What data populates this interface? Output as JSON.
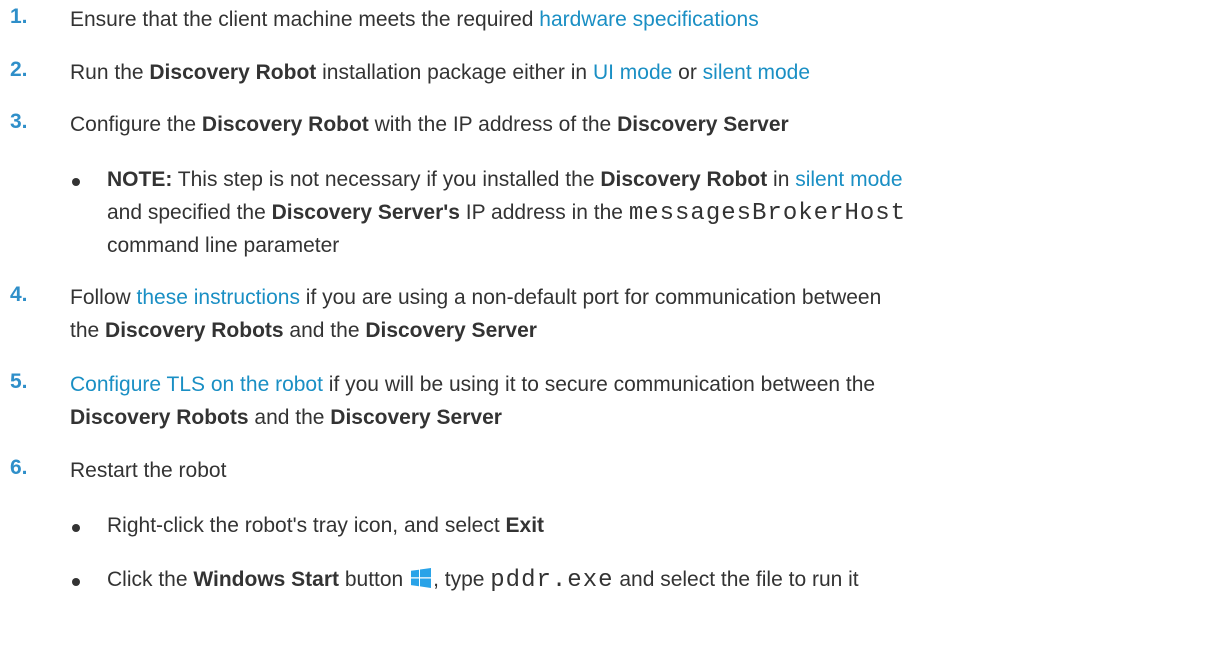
{
  "steps": [
    {
      "number": "1.",
      "parts": {
        "t1": "Ensure that the client machine meets the required ",
        "link1": "hardware specifications"
      }
    },
    {
      "number": "2.",
      "parts": {
        "t1": "Run the ",
        "b1": "Discovery Robot",
        "t2": " installation package either in ",
        "link1": "UI mode",
        "t3": " or ",
        "link2": "silent mode"
      }
    },
    {
      "number": "3.",
      "parts": {
        "t1": "Configure the ",
        "b1": "Discovery Robot",
        "t2": " with the IP address of the ",
        "b2": "Discovery Server"
      },
      "note": {
        "label": "NOTE:",
        "t1": " This step is not necessary if you installed the ",
        "b1": "Discovery Robot",
        "t2": " in ",
        "link1": "silent mode",
        "t3": "and specified the ",
        "b2": "Discovery Server's",
        "t4": " IP address in the ",
        "code": "messagesBrokerHost",
        "t5": "command line parameter"
      }
    },
    {
      "number": "4.",
      "parts": {
        "t1": "Follow ",
        "link1": "these instructions",
        "t2": " if you are using a non-default port for communication between",
        "t3": "the ",
        "b1": "Discovery Robots",
        "t4": " and the ",
        "b2": "Discovery Server"
      }
    },
    {
      "number": "5.",
      "parts": {
        "link1": "Configure TLS on the robot",
        "t1": " if you will be using it to secure communication between the",
        "b1": "Discovery Robots",
        "t2": " and the ",
        "b2": "Discovery Server"
      }
    },
    {
      "number": "6.",
      "parts": {
        "t1": "Restart the robot"
      },
      "subitems": [
        {
          "t1": "Right-click the robot's tray icon, and select ",
          "b1": "Exit"
        },
        {
          "t1": "Click the ",
          "b1": "Windows Start",
          "t2": " button ",
          "icon": "windows-logo-icon",
          "t3": ", type ",
          "code": "pddr.exe",
          "t4": " and select the file to run it"
        }
      ]
    }
  ],
  "colors": {
    "step_number": "#2f8fc9",
    "link": "#1a8fc4",
    "text": "#333333",
    "windows_logo": "#29a3e8"
  }
}
